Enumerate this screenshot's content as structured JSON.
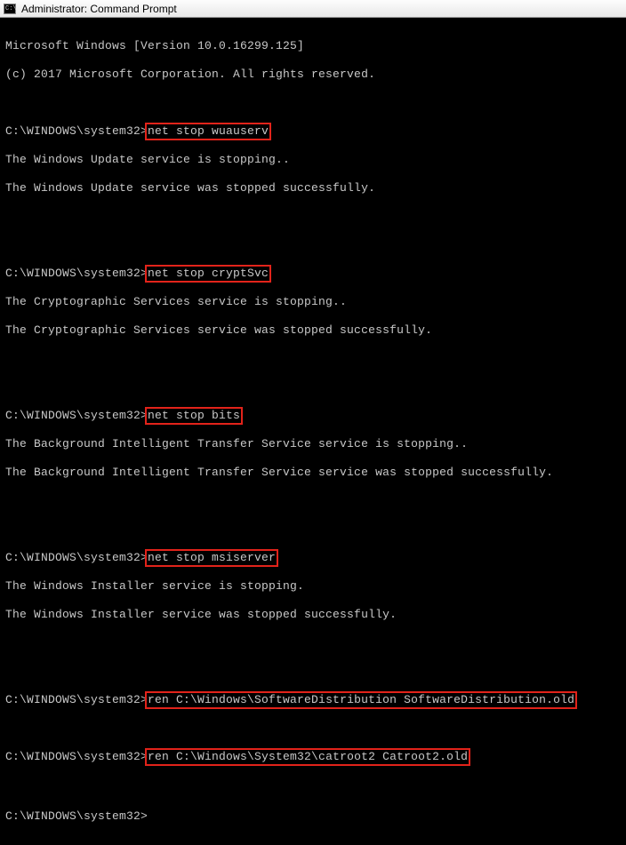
{
  "window": {
    "title": "Administrator: Command Prompt"
  },
  "header": {
    "line1": "Microsoft Windows [Version 10.0.16299.125]",
    "line2": "(c) 2017 Microsoft Corporation. All rights reserved."
  },
  "prompt": "C:\\WINDOWS\\system32>",
  "blocks": [
    {
      "cmd": "net stop wuauserv",
      "out1": "The Windows Update service is stopping..",
      "out2": "The Windows Update service was stopped successfully."
    },
    {
      "cmd": "net stop cryptSvc",
      "out1": "The Cryptographic Services service is stopping..",
      "out2": "The Cryptographic Services service was stopped successfully."
    },
    {
      "cmd": "net stop bits",
      "out1": "The Background Intelligent Transfer Service service is stopping..",
      "out2": "The Background Intelligent Transfer Service service was stopped successfully."
    },
    {
      "cmd": "net stop msiserver",
      "out1": "The Windows Installer service is stopping.",
      "out2": "The Windows Installer service was stopped successfully."
    }
  ],
  "rename": {
    "cmd1": "ren C:\\Windows\\SoftwareDistribution SoftwareDistribution.old",
    "cmd2": "ren C:\\Windows\\System32\\catroot2 Catroot2.old"
  }
}
